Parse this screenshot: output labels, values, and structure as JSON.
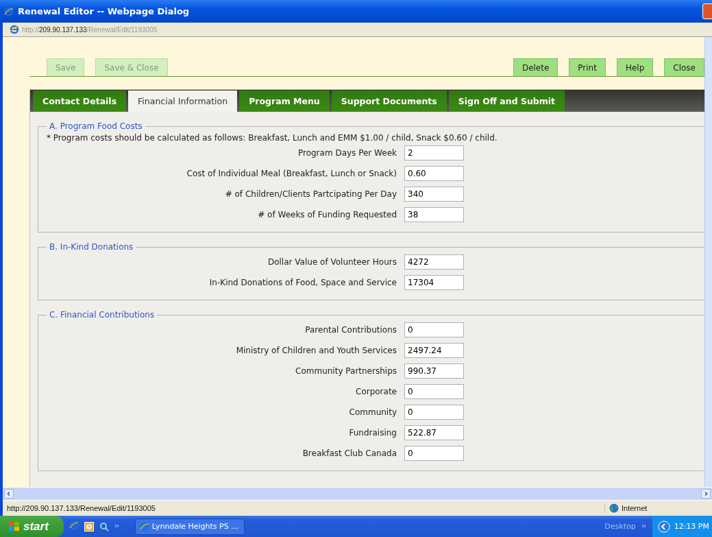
{
  "window": {
    "title": "Renewal Editor -- Webpage Dialog"
  },
  "address_bar": {
    "scheme": "http://",
    "host": "209.90.137.133",
    "path": "/Renewal/Edit/1193005"
  },
  "toolbar": {
    "left_buttons": [
      {
        "label": "Save",
        "disabled": true
      },
      {
        "label": "Save & Close",
        "disabled": true
      }
    ],
    "right_buttons": [
      {
        "label": "Delete",
        "disabled": false
      },
      {
        "label": "Print",
        "disabled": false
      },
      {
        "label": "Help",
        "disabled": false
      },
      {
        "label": "Close",
        "disabled": false
      }
    ]
  },
  "tabs": [
    {
      "label": "Contact Details",
      "selected": false
    },
    {
      "label": "Financial Information",
      "selected": true
    },
    {
      "label": "Program Menu",
      "selected": false
    },
    {
      "label": "Support Documents",
      "selected": false
    },
    {
      "label": "Sign Off and Submit",
      "selected": false
    }
  ],
  "sections": [
    {
      "title": "A. Program Food Costs",
      "note": "* Program costs should be calculated as follows: Breakfast, Lunch and EMM $1.00 / child, Snack $0.60 / child.",
      "fields": [
        {
          "label": "Program Days Per Week",
          "value": "2"
        },
        {
          "label": "Cost of Individual Meal (Breakfast, Lunch or Snack)",
          "value": "0.60"
        },
        {
          "label": "# of Children/Clients Partcipating Per Day",
          "value": "340"
        },
        {
          "label": "# of Weeks of Funding Requested",
          "value": "38"
        }
      ]
    },
    {
      "title": "B. In-Kind Donations",
      "fields": [
        {
          "label": "Dollar Value of Volunteer Hours",
          "value": "4272"
        },
        {
          "label": "In-Kind Donations of Food, Space and Service",
          "value": "17304"
        }
      ]
    },
    {
      "title": "C. Financial Contributions",
      "fields": [
        {
          "label": "Parental Contributions",
          "value": "0"
        },
        {
          "label": "Ministry of Children and Youth Services",
          "value": "2497.24"
        },
        {
          "label": "Community Partnerships",
          "value": "990.37"
        },
        {
          "label": "Corporate",
          "value": "0"
        },
        {
          "label": "Community",
          "value": "0"
        },
        {
          "label": "Fundraising",
          "value": "522.87"
        },
        {
          "label": "Breakfast Club Canada",
          "value": "0"
        }
      ]
    }
  ],
  "status_bar": {
    "url": "http://209.90.137.133/Renewal/Edit/1193005",
    "zone": "Internet"
  },
  "taskbar": {
    "start": "start",
    "task": "Lynndale Heights PS ...",
    "desktop": "Desktop",
    "time": "12:13 PM"
  }
}
